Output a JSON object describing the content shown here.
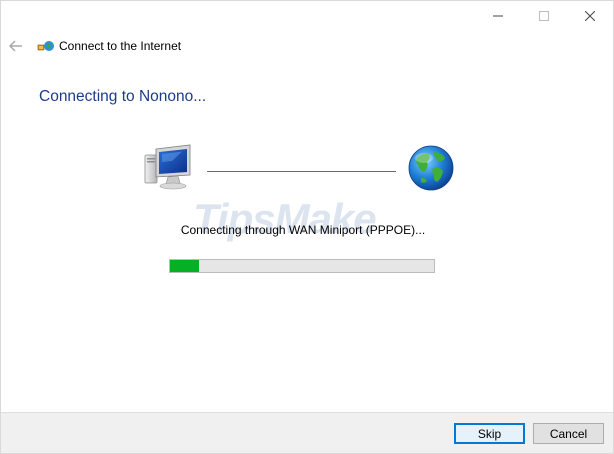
{
  "window": {
    "title": "Connect to the Internet",
    "caption_buttons": [
      "minimize-icon",
      "maximize-icon",
      "close-icon"
    ]
  },
  "nav": {
    "back_icon": "back-arrow-icon",
    "app_icon": "network-globe-icon"
  },
  "main": {
    "heading": "Connecting to Nonono...",
    "source_icon": "computer-monitor-icon",
    "destination_icon": "globe-icon",
    "status_text": "Connecting through WAN Miniport (PPPOE)...",
    "progress_fraction": 0.11,
    "watermark": "TipsMake"
  },
  "footer": {
    "skip_label": "Skip",
    "cancel_label": "Cancel"
  },
  "colors": {
    "heading": "#1c3c8a",
    "progress_fill": "#06b025",
    "default_button_border": "#0078d7",
    "footer_bg": "#f0f0f0"
  }
}
